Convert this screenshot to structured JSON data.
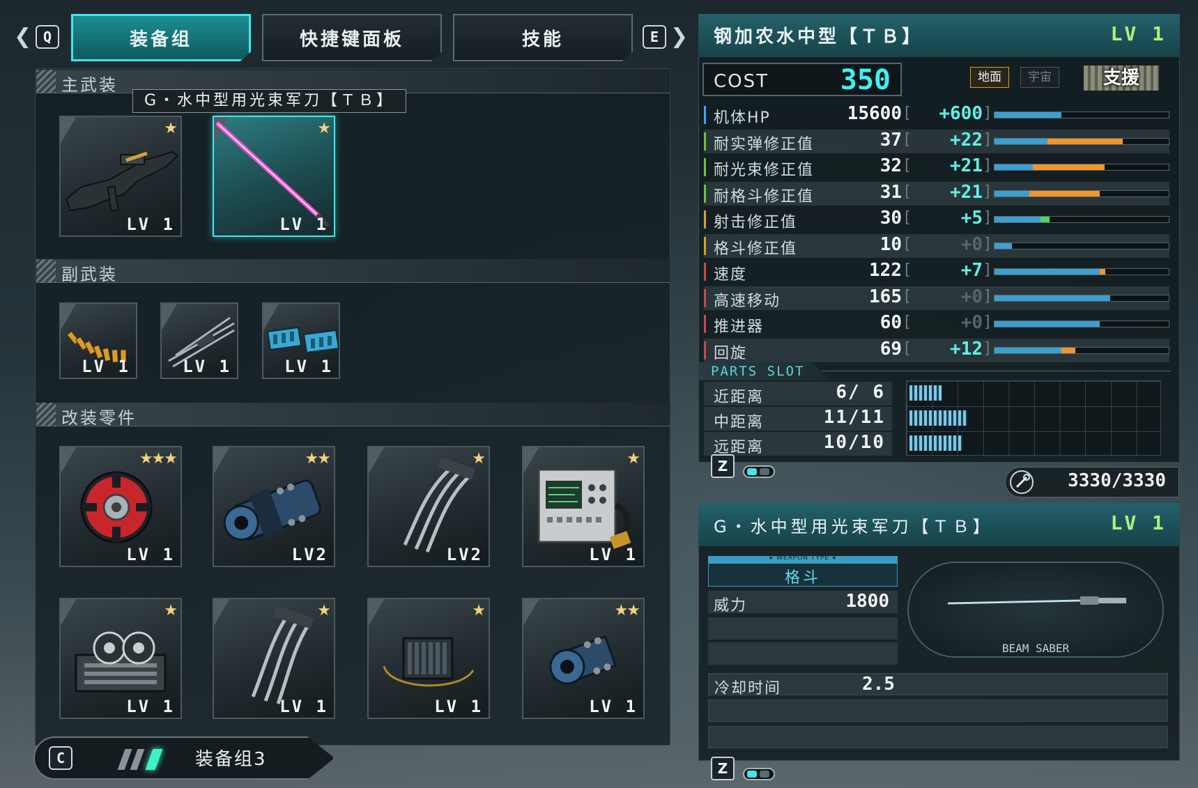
{
  "nav": {
    "prev_key": "Q",
    "next_key": "E",
    "tabs": [
      {
        "label": "装备组",
        "active": true
      },
      {
        "label": "快捷键面板",
        "active": false
      },
      {
        "label": "技能",
        "active": false
      }
    ]
  },
  "loadout": {
    "main_header": "主武装",
    "sub_header": "副武装",
    "parts_header": "改装零件",
    "tooltip": "G・水中型用光束军刀【ＴＢ】",
    "main_weapons": [
      {
        "name": "beam-rifle",
        "stars": "★",
        "level": "LV 1",
        "selected": false
      },
      {
        "name": "beam-saber",
        "stars": "★",
        "level": "LV 1",
        "selected": true
      }
    ],
    "sub_weapons": [
      {
        "name": "ammo-belt",
        "level": "LV 1"
      },
      {
        "name": "claw-blade",
        "level": "LV 1"
      },
      {
        "name": "missile-pods",
        "level": "LV 1"
      }
    ],
    "parts": [
      {
        "name": "red-gear-part",
        "stars": "★★★",
        "level": "LV 1"
      },
      {
        "name": "gatling-part",
        "stars": "★★",
        "level": "LV2"
      },
      {
        "name": "hook-part",
        "stars": "★",
        "level": "LV2"
      },
      {
        "name": "radio-part",
        "stars": "★",
        "level": "LV 1"
      },
      {
        "name": "engine-part",
        "stars": "★",
        "level": "LV 1"
      },
      {
        "name": "hook-part-2",
        "stars": "★",
        "level": "LV 1"
      },
      {
        "name": "coil-part",
        "stars": "★",
        "level": "LV 1"
      },
      {
        "name": "joint-part",
        "stars": "★★",
        "level": "LV 1"
      }
    ],
    "group_key": "C",
    "group_label": "装备组3"
  },
  "unit": {
    "name": "钢加农水中型【ＴＢ】",
    "level": "LV 1",
    "cost_label": "COST",
    "cost_value": "350",
    "terrain_ground": "地面",
    "terrain_space": "宇宙",
    "role": "支援",
    "colors": {
      "accent": "#3fe8ec",
      "boost": "#f0962a",
      "bar": "#3c9fcf",
      "level": "#aef27a"
    },
    "stats": [
      {
        "label": "机体HP",
        "value": "15600",
        "bonus": "+600",
        "base_frac": 0.38,
        "bonus_frac": 0.0,
        "tick": "#3fa3ff"
      },
      {
        "label": "耐实弹修正值",
        "value": "37",
        "bonus": "+22",
        "base_frac": 0.3,
        "bonus_frac": 0.43,
        "tick": "#6fc13a"
      },
      {
        "label": "耐光束修正值",
        "value": "32",
        "bonus": "+21",
        "base_frac": 0.22,
        "bonus_frac": 0.41,
        "tick": "#6fc13a"
      },
      {
        "label": "耐格斗修正值",
        "value": "31",
        "bonus": "+21",
        "base_frac": 0.2,
        "bonus_frac": 0.4,
        "tick": "#6fc13a"
      },
      {
        "label": "射击修正值",
        "value": "30",
        "bonus": "+5",
        "base_frac": 0.26,
        "bonus_frac": 0.05,
        "tick": "#d6a02a",
        "green": true
      },
      {
        "label": "格斗修正值",
        "value": "10",
        "bonus": "+0",
        "base_frac": 0.1,
        "bonus_frac": 0.0,
        "tick": "#d6a02a"
      },
      {
        "label": "速度",
        "value": "122",
        "bonus": "+7",
        "base_frac": 0.6,
        "bonus_frac": 0.03,
        "tick": "#c84a4a"
      },
      {
        "label": "高速移动",
        "value": "165",
        "bonus": "+0",
        "base_frac": 0.66,
        "bonus_frac": 0.0,
        "tick": "#c84a4a"
      },
      {
        "label": "推进器",
        "value": "60",
        "bonus": "+0",
        "base_frac": 0.6,
        "bonus_frac": 0.0,
        "tick": "#c84a4a"
      },
      {
        "label": "回旋",
        "value": "69",
        "bonus": "+12",
        "base_frac": 0.38,
        "bonus_frac": 0.08,
        "tick": "#c84a4a"
      }
    ],
    "parts_slot_title": "PARTS SLOT",
    "parts_slots": [
      {
        "label": "近距离",
        "value": "6/ 6",
        "fill_frac": 0.13
      },
      {
        "label": "中距离",
        "value": "11/11",
        "fill_frac": 0.23
      },
      {
        "label": "远距离",
        "value": "10/10",
        "fill_frac": 0.21
      }
    ],
    "toggle_key": "Z",
    "repair_value": "3330/3330"
  },
  "weapon": {
    "name": "G・水中型用光束军刀【ＴＢ】",
    "level": "LV 1",
    "type_caption": "▸ WEAPON TYPE ◂",
    "type": "格斗",
    "power_label": "威力",
    "power_value": "1800",
    "image_caption": "BEAM SABER",
    "cooldown_label": "冷却时间",
    "cooldown_value": "2.5",
    "toggle_key": "Z"
  }
}
